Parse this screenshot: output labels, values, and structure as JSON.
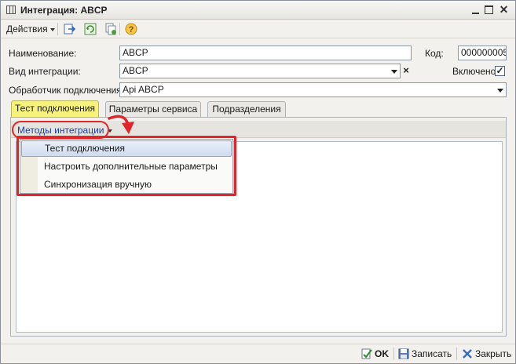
{
  "window": {
    "title": "Интеграция: ABCP"
  },
  "toolbar": {
    "actions_label": "Действия",
    "icons": [
      "move-icon",
      "refresh-icon",
      "copy-icon",
      "help-icon"
    ]
  },
  "form": {
    "name_label": "Наименование:",
    "name_value": "ABCP",
    "code_label": "Код:",
    "code_value": "000000005",
    "integration_type_label": "Вид интеграции:",
    "integration_type_value": "ABCP",
    "enabled_label": "Включено",
    "enabled_checked": true,
    "handler_label": "Обработчик подключения:",
    "handler_value": "Api ABCP"
  },
  "tabs": [
    {
      "label": "Тест подключения",
      "active": true
    },
    {
      "label": "Параметры сервиса",
      "active": false
    },
    {
      "label": "Подразделения",
      "active": false
    }
  ],
  "panel": {
    "methods_label": "Методы интеграции",
    "menu_items": [
      {
        "label": "Тест подключения",
        "highlighted": true
      },
      {
        "label": "Настроить дополнительные параметры",
        "highlighted": false
      },
      {
        "label": "Синхронизация вручную",
        "highlighted": false
      }
    ]
  },
  "bottom": {
    "ok_label": "OK",
    "save_label": "Записать",
    "close_label": "Закрыть"
  },
  "colors": {
    "active_tab": "#f7f27b",
    "annotation_red": "#e0262b",
    "link_blue": "#1f3f9a"
  }
}
